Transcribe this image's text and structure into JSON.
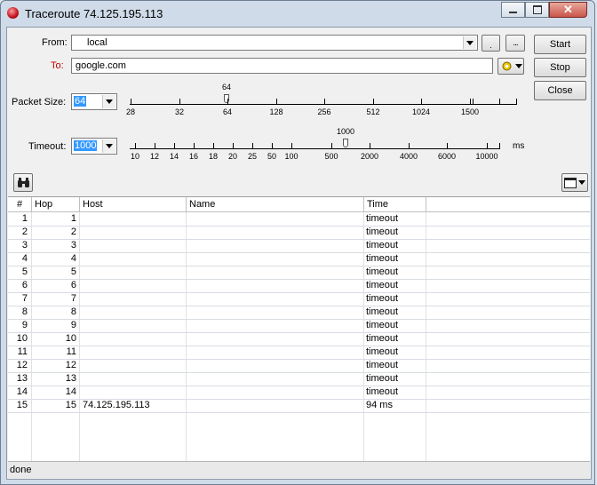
{
  "window": {
    "title": "Traceroute 74.125.195.113"
  },
  "form": {
    "from_label": "From:",
    "from_value": "local",
    "to_label": "To:",
    "to_value": "google.com",
    "packet_size_label": "Packet Size:",
    "packet_size_value": "64",
    "timeout_label": "Timeout:",
    "timeout_value": "1000",
    "timeout_unit": "ms"
  },
  "packet_slider": {
    "value_label": "64",
    "ticks": [
      "28",
      "32",
      "64",
      "128",
      "256",
      "512",
      "1024",
      "1500"
    ]
  },
  "timeout_slider": {
    "value_label": "1000",
    "ticks": [
      "10",
      "12",
      "14",
      "16",
      "18",
      "20",
      "25",
      "50",
      "100",
      "500",
      "2000",
      "4000",
      "6000",
      "10000"
    ]
  },
  "buttons": {
    "start": "Start",
    "stop": "Stop",
    "close": "Close",
    "ellipsis": "...",
    "small": "."
  },
  "table": {
    "columns": [
      "#",
      "Hop",
      "Host",
      "Name",
      "Time"
    ],
    "rows": [
      [
        "1",
        "1",
        "",
        "",
        "timeout"
      ],
      [
        "2",
        "2",
        "",
        "",
        "timeout"
      ],
      [
        "3",
        "3",
        "",
        "",
        "timeout"
      ],
      [
        "4",
        "4",
        "",
        "",
        "timeout"
      ],
      [
        "5",
        "5",
        "",
        "",
        "timeout"
      ],
      [
        "6",
        "6",
        "",
        "",
        "timeout"
      ],
      [
        "7",
        "7",
        "",
        "",
        "timeout"
      ],
      [
        "8",
        "8",
        "",
        "",
        "timeout"
      ],
      [
        "9",
        "9",
        "",
        "",
        "timeout"
      ],
      [
        "10",
        "10",
        "",
        "",
        "timeout"
      ],
      [
        "11",
        "11",
        "",
        "",
        "timeout"
      ],
      [
        "12",
        "12",
        "",
        "",
        "timeout"
      ],
      [
        "13",
        "13",
        "",
        "",
        "timeout"
      ],
      [
        "14",
        "14",
        "",
        "",
        "timeout"
      ],
      [
        "15",
        "15",
        "74.125.195.113",
        "",
        "94 ms"
      ]
    ]
  },
  "status": {
    "text": "done"
  },
  "colors": {
    "to_label": "#c00000",
    "selection": "#3399ff"
  }
}
